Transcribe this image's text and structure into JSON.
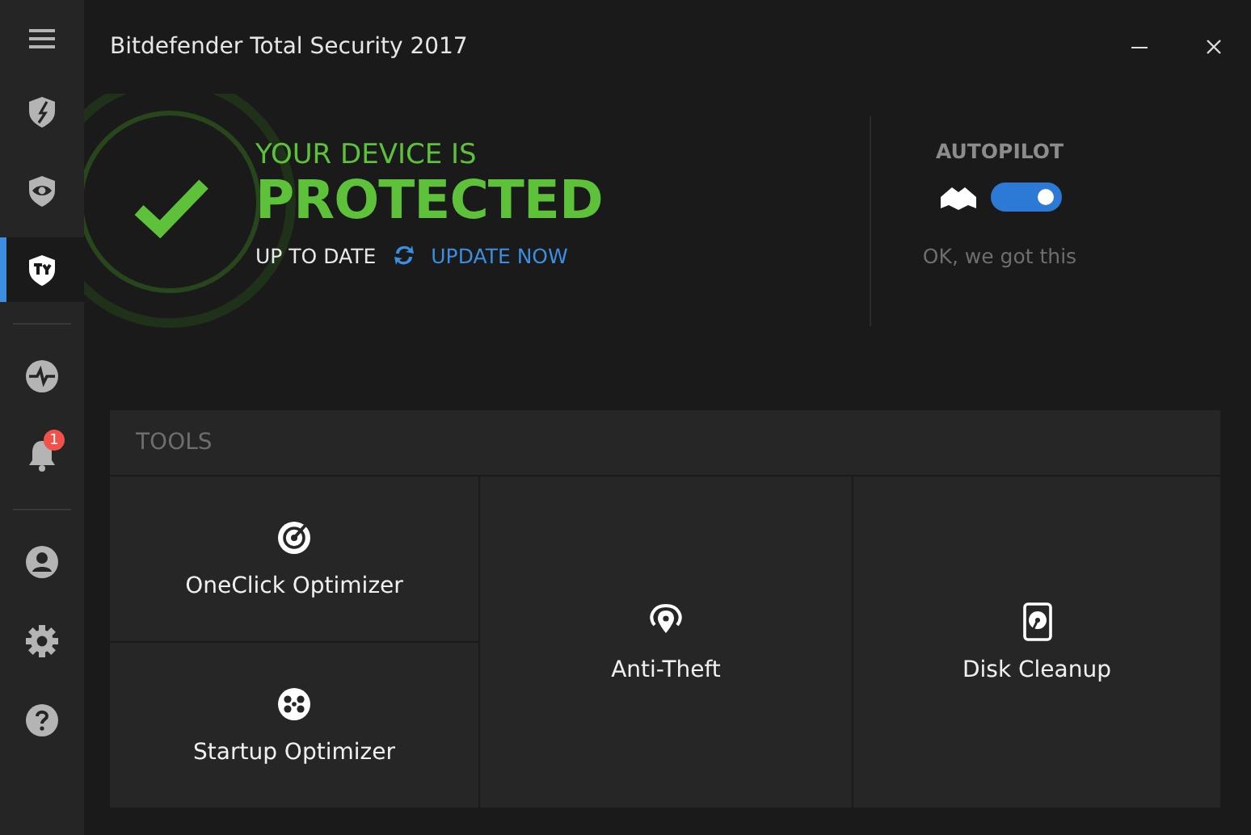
{
  "window": {
    "title": "Bitdefender Total Security 2017"
  },
  "sidebar": {
    "items": [
      {
        "kind": "menu",
        "selected": false
      },
      {
        "kind": "shield",
        "selected": false
      },
      {
        "kind": "privacy",
        "selected": false
      },
      {
        "kind": "tools",
        "selected": true
      },
      {
        "kind": "divider"
      },
      {
        "kind": "activity",
        "selected": false
      },
      {
        "kind": "notifications",
        "selected": false,
        "badge": "1"
      },
      {
        "kind": "divider"
      },
      {
        "kind": "account",
        "selected": false
      },
      {
        "kind": "settings",
        "selected": false
      },
      {
        "kind": "help",
        "selected": false
      }
    ]
  },
  "status": {
    "heading": "YOUR DEVICE IS",
    "state": "PROTECTED",
    "update_status": "UP TO DATE",
    "update_link": "UPDATE NOW"
  },
  "autopilot": {
    "label": "AUTOPILOT",
    "on": true,
    "caption": "OK, we got this"
  },
  "tools": {
    "title": "TOOLS",
    "items": [
      {
        "label": "OneClick Optimizer",
        "kind": "optimizer"
      },
      {
        "label": "Startup Optimizer",
        "kind": "startup"
      },
      {
        "label": "Anti-Theft",
        "kind": "antitheft"
      },
      {
        "label": "Disk Cleanup",
        "kind": "disk"
      }
    ]
  }
}
